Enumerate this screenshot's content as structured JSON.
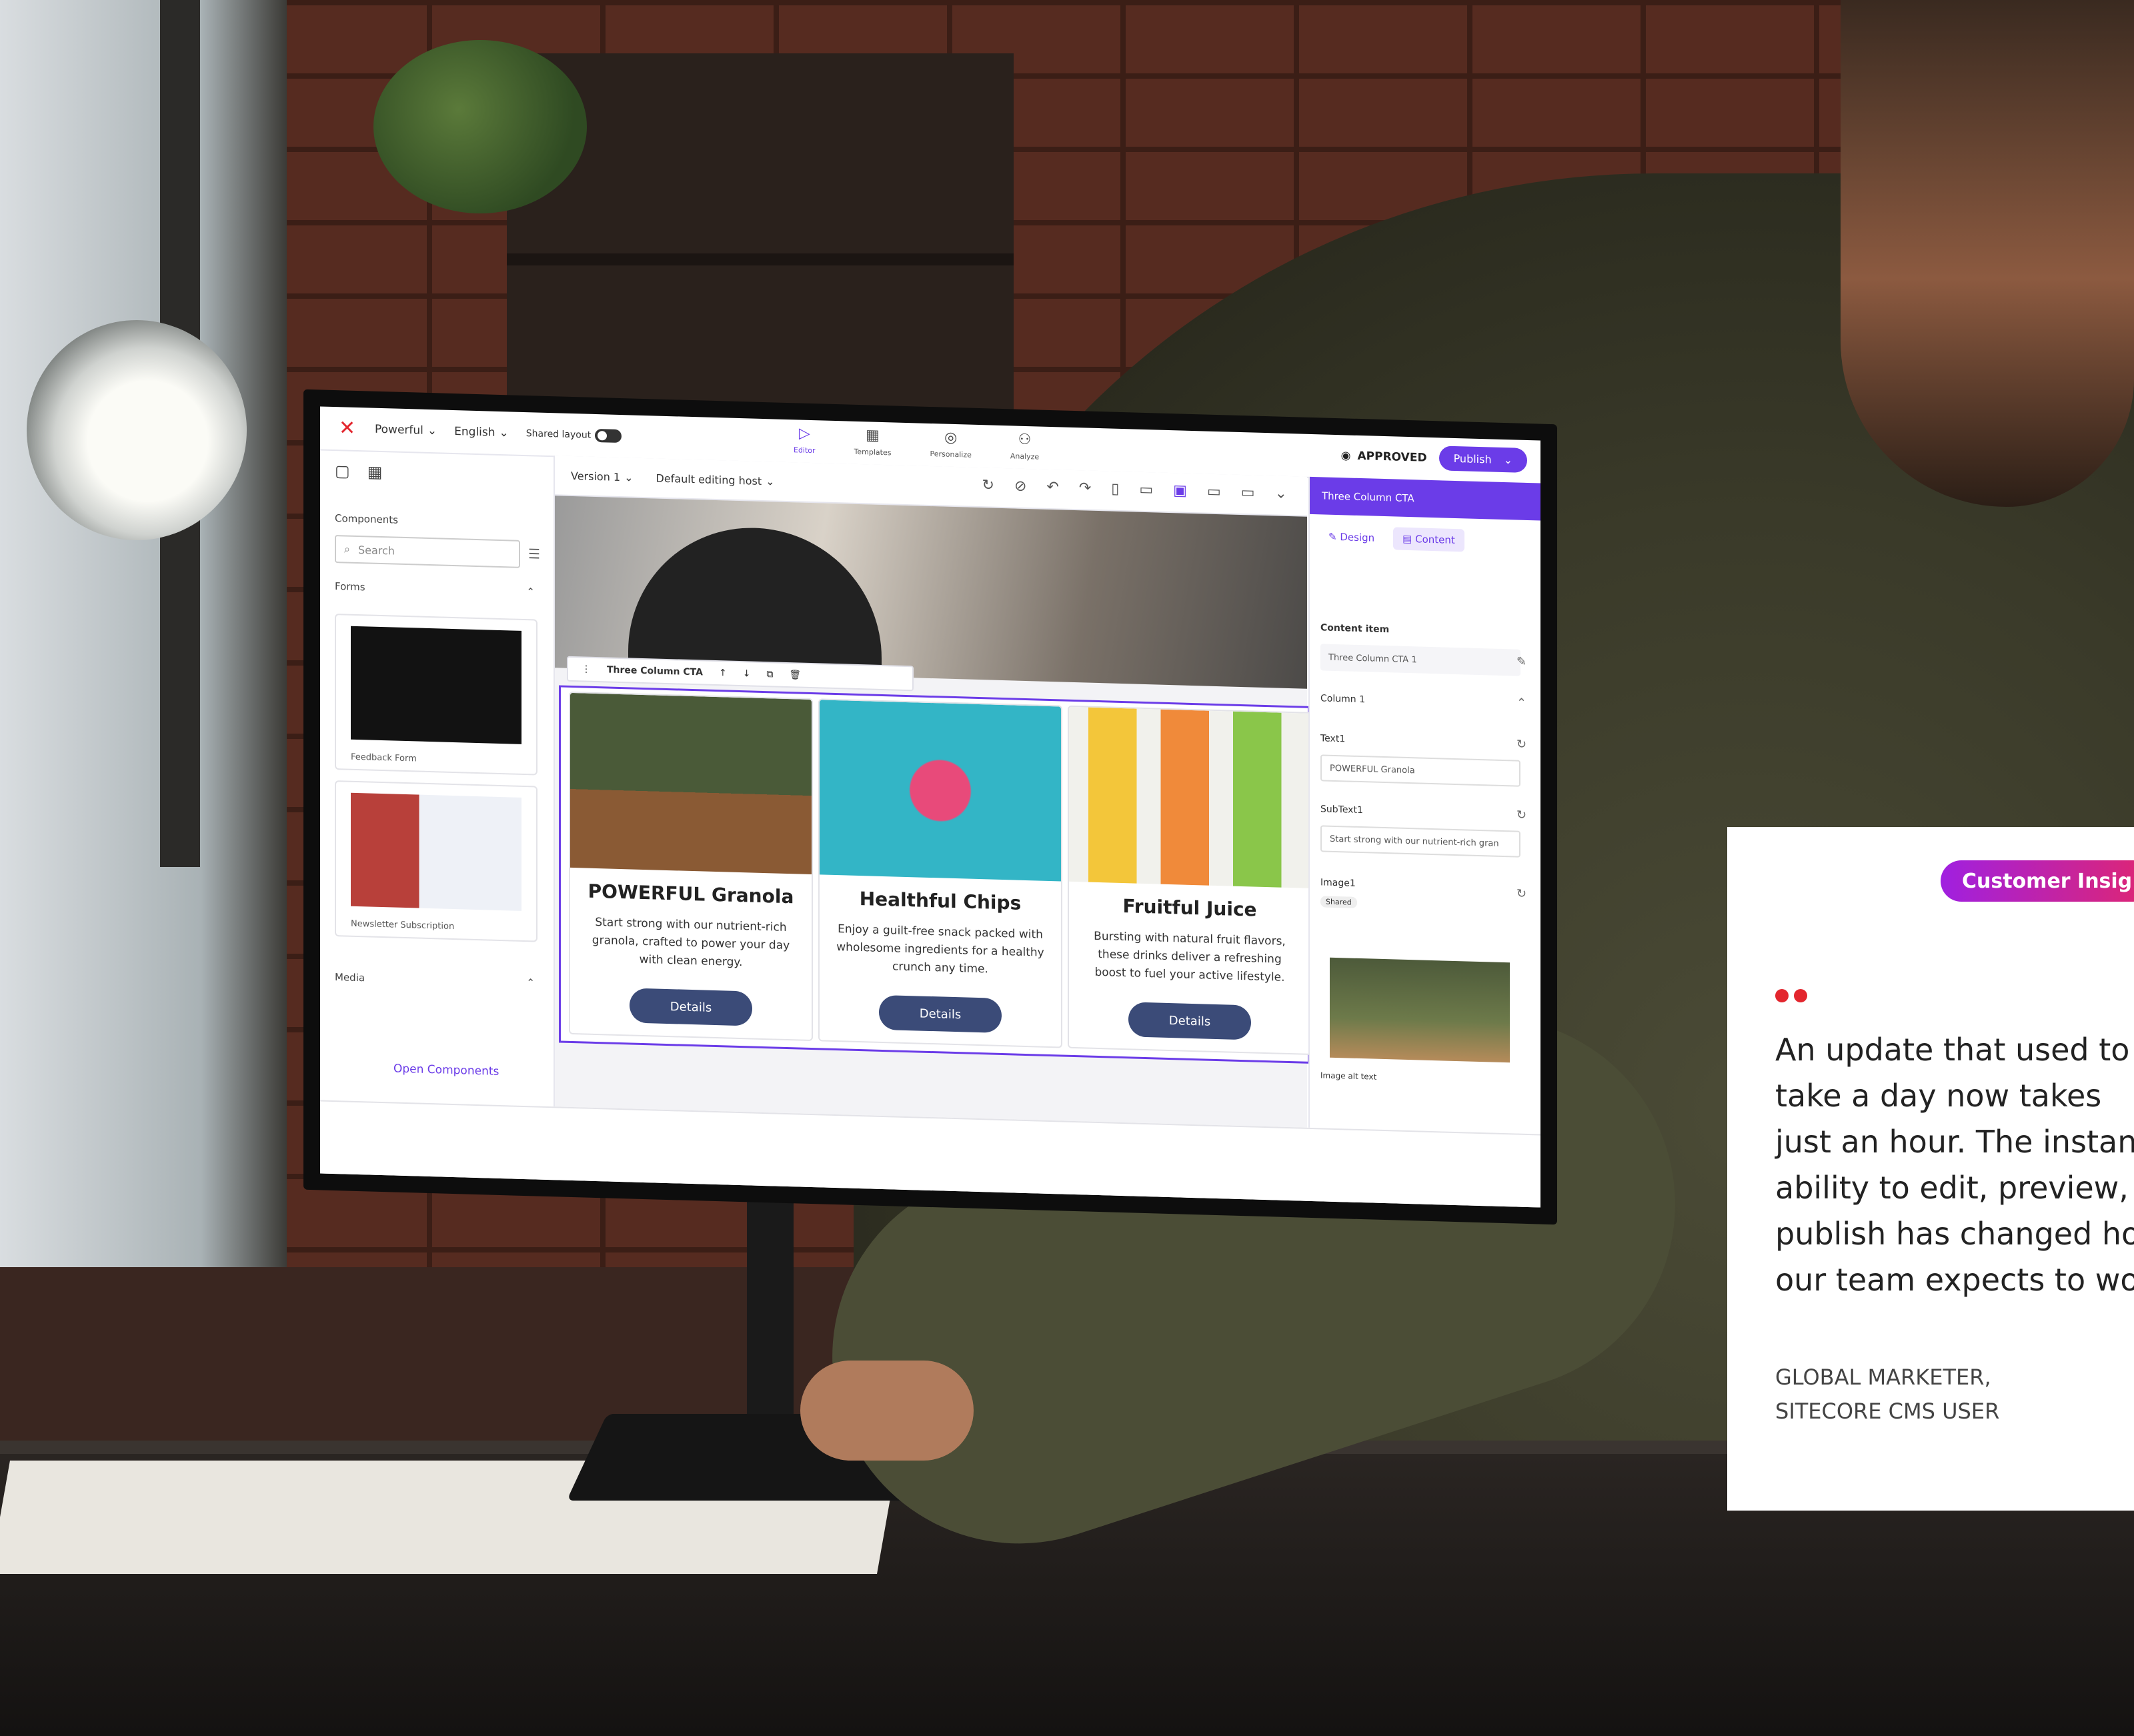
{
  "app": {
    "site_name": "Powerful",
    "language": "English",
    "shared_layout_label": "Shared layout",
    "nav_tabs": [
      "Editor",
      "Templates",
      "Personalize",
      "Analyze"
    ],
    "status": "APPROVED",
    "publish_label": "Publish"
  },
  "left_panel": {
    "title": "Components",
    "search_placeholder": "Search",
    "sections": [
      "Forms",
      "Media"
    ],
    "cards": [
      "Feedback Form",
      "Newsletter Subscription"
    ],
    "open_components": "Open Components"
  },
  "canvas": {
    "version": "Version 1",
    "editing_host": "Default editing host",
    "component_name": "Three Column CTA",
    "cards": [
      {
        "title": "POWERFUL Granola",
        "body": "Start strong with our nutrient-rich granola, crafted to power your day with clean energy.",
        "button": "Details"
      },
      {
        "title": "Healthful Chips",
        "body": "Enjoy a guilt-free snack packed with wholesome ingredients for a healthy crunch any time.",
        "button": "Details"
      },
      {
        "title": "Fruitful Juice",
        "body": "Bursting with natural fruit flavors, these drinks deliver a refreshing boost to fuel your active lifestyle.",
        "button": "Details"
      }
    ]
  },
  "right_panel": {
    "header": "Three Column CTA",
    "tabs": [
      "Design",
      "Content"
    ],
    "content_item_label": "Content item",
    "content_item": "Three Column CTA 1",
    "column": "Column 1",
    "text1_label": "Text1",
    "text1_value": "POWERFUL Granola",
    "subtext1_label": "SubText1",
    "subtext1_value": "Start strong with our nutrient-rich gran",
    "image1_label": "Image1",
    "image1_tag": "Shared",
    "image_alt_label": "Image alt text"
  },
  "quote_card": {
    "badge": "Customer Insig",
    "lines": [
      "An update that used to",
      "take a day now takes",
      "just an hour. The instant",
      "ability to edit, preview, a",
      "publish has changed ho",
      "our team expects to wo"
    ],
    "attribution": [
      "GLOBAL MARKETER,",
      "SITECORE CMS USER"
    ]
  },
  "colors": {
    "accent": "#6b3ce8",
    "brand_red": "#e3262e",
    "button_navy": "#3b4b78"
  }
}
